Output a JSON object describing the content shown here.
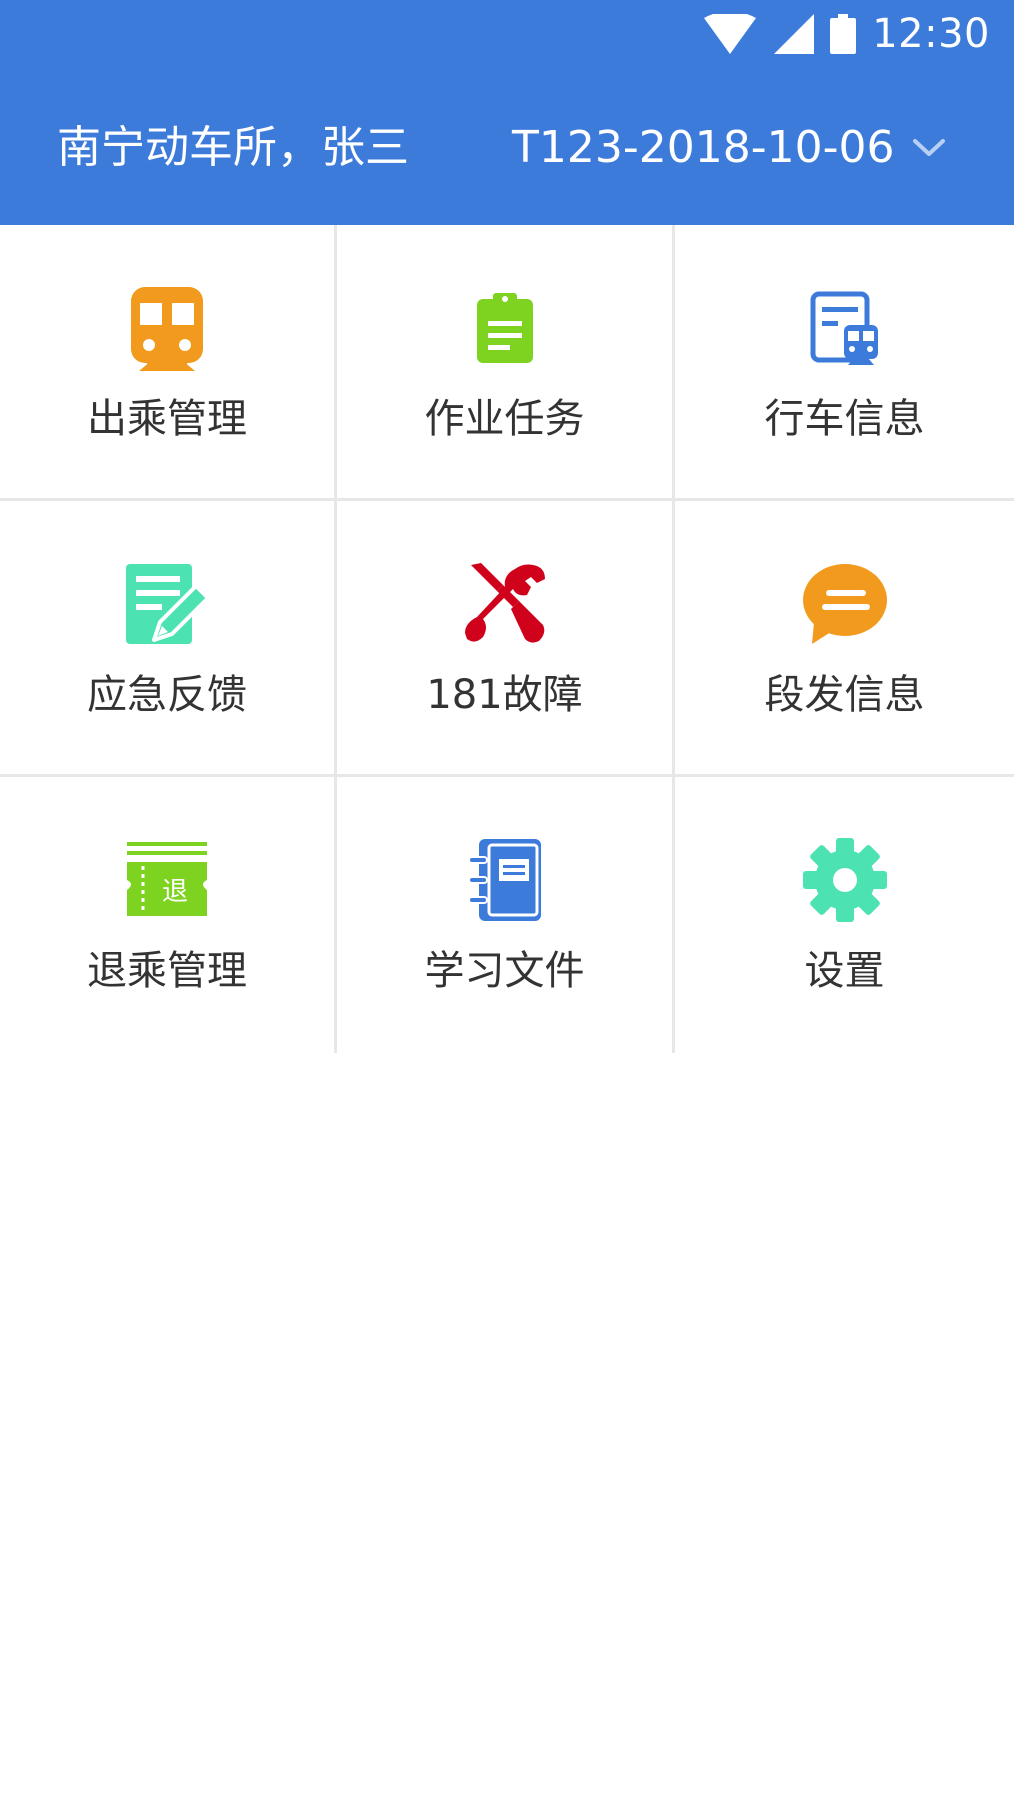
{
  "status_bar": {
    "time": "12:30",
    "icons": [
      "wifi-icon",
      "signal-icon",
      "battery-icon"
    ]
  },
  "header": {
    "station_user": "南宁动车所，张三",
    "train_selector": {
      "selected": "T123-2018-10-06",
      "icon": "chevron-down-icon"
    },
    "background_color": "#3d7bdb"
  },
  "menu": {
    "items": [
      {
        "label": "出乘管理",
        "icon": "train-icon",
        "color": "#f29a1e"
      },
      {
        "label": "作业任务",
        "icon": "clipboard-icon",
        "color": "#7ed321"
      },
      {
        "label": "行车信息",
        "icon": "train-info-icon",
        "color": "#3d7bdb"
      },
      {
        "label": "应急反馈",
        "icon": "edit-document-icon",
        "color": "#4ce2b2"
      },
      {
        "label": "181故障",
        "icon": "repair-tools-icon",
        "color": "#d0021b"
      },
      {
        "label": "段发信息",
        "icon": "message-bubble-icon",
        "color": "#f29a1e"
      },
      {
        "label": "退乘管理",
        "icon": "refund-ticket-icon",
        "color": "#7ed321",
        "icon_text": "退"
      },
      {
        "label": "学习文件",
        "icon": "notebook-icon",
        "color": "#3d7bdb"
      },
      {
        "label": "设置",
        "icon": "gear-icon",
        "color": "#4ce2b2"
      }
    ]
  }
}
